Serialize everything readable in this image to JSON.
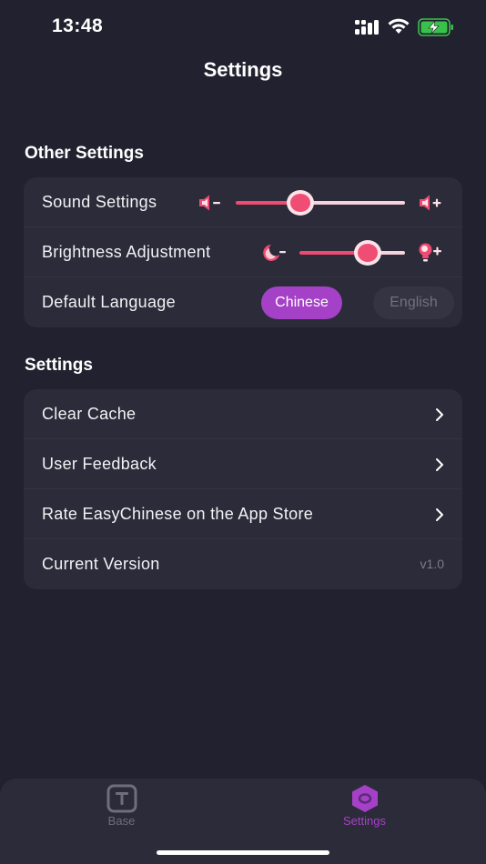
{
  "status_bar": {
    "time": "13:48",
    "battery_color": "#39c24a"
  },
  "page": {
    "title": "Settings"
  },
  "other_settings": {
    "title": "Other Settings",
    "sound": {
      "label": "Sound Settings",
      "level": 0.38
    },
    "brightness": {
      "label": "Brightness Adjustment",
      "level": 0.65
    },
    "language": {
      "label": "Default Language",
      "options": [
        "Chinese",
        "English"
      ],
      "selected": "Chinese"
    }
  },
  "settings": {
    "title": "Settings",
    "items": [
      {
        "label": "Clear Cache"
      },
      {
        "label": "User Feedback"
      },
      {
        "label": "Rate EasyChinese on the App Store"
      }
    ],
    "version": {
      "label": "Current Version",
      "value": "v1.0"
    }
  },
  "tab_bar": {
    "tabs": [
      {
        "label": "Base",
        "icon": "text-box-icon",
        "active": false
      },
      {
        "label": "Settings",
        "icon": "hexagon-icon",
        "active": true
      }
    ]
  },
  "colors": {
    "background": "#22212f",
    "card": "#2c2b39",
    "accent_pink": "#ef4b72",
    "accent_purple": "#a541c6"
  }
}
